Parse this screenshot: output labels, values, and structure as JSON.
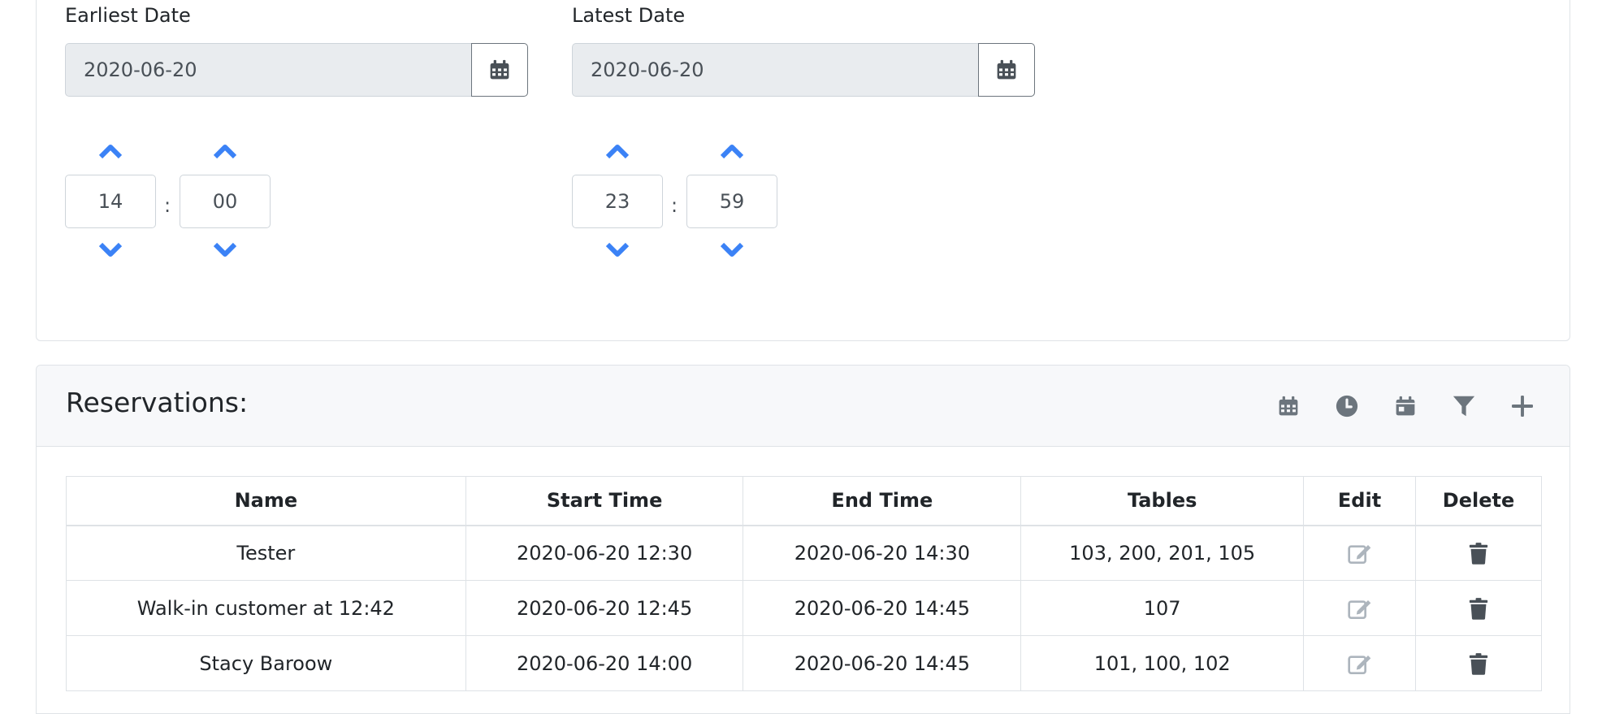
{
  "filter": {
    "earliest": {
      "label": "Earliest Date",
      "date": "2020-06-20",
      "hour": "14",
      "minute": "00"
    },
    "latest": {
      "label": "Latest Date",
      "date": "2020-06-20",
      "hour": "23",
      "minute": "59"
    },
    "separator": ":"
  },
  "reservations": {
    "title": "Reservations:",
    "toolbar_icons": [
      "calendar-icon",
      "clock-icon",
      "calendar-day-icon",
      "filter-icon",
      "plus-icon"
    ],
    "columns": [
      "Name",
      "Start Time",
      "End Time",
      "Tables",
      "Edit",
      "Delete"
    ],
    "rows": [
      {
        "name": "Tester",
        "start": "2020-06-20 12:30",
        "end": "2020-06-20 14:30",
        "tables": "103, 200, 201, 105"
      },
      {
        "name": "Walk-in customer at 12:42",
        "start": "2020-06-20 12:45",
        "end": "2020-06-20 14:45",
        "tables": "107"
      },
      {
        "name": "Stacy Baroow",
        "start": "2020-06-20 14:00",
        "end": "2020-06-20 14:45",
        "tables": "101, 100, 102"
      }
    ]
  },
  "colors": {
    "accent": "#3b82f6",
    "icon_gray": "#6c757d",
    "border": "#dee2e6",
    "input_bg": "#e9ecef"
  }
}
